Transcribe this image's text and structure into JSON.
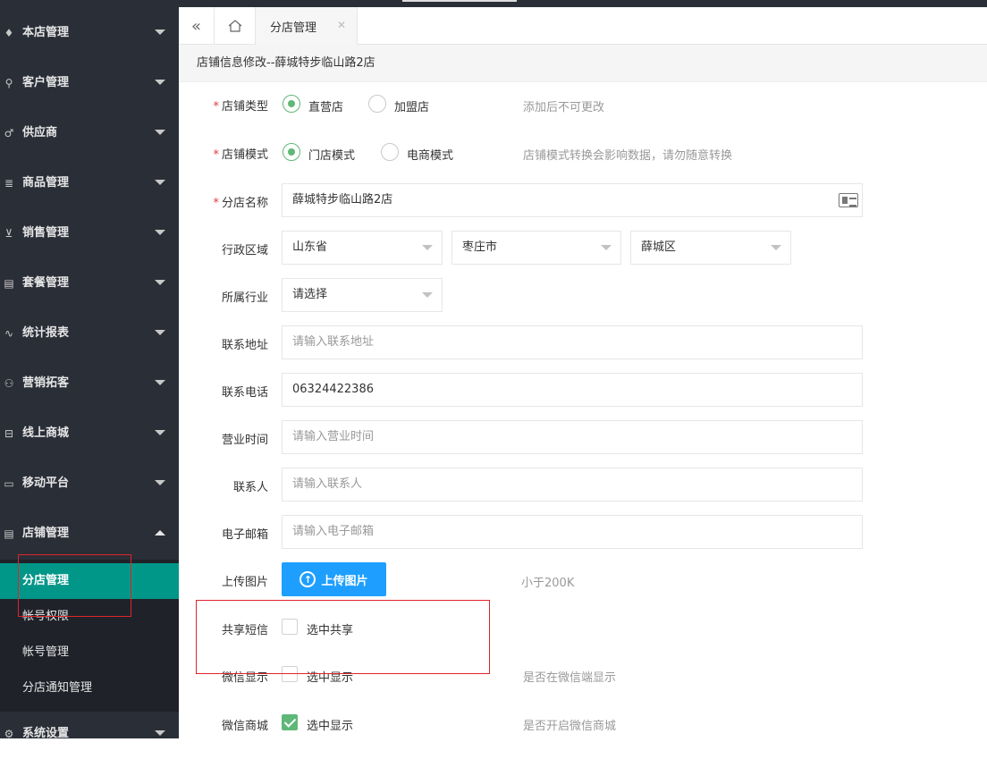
{
  "sidebar": {
    "items": [
      {
        "label": "本店管理",
        "icon": "diamond-icon"
      },
      {
        "label": "客户管理",
        "icon": "user-icon"
      },
      {
        "label": "供应商",
        "icon": "male-icon"
      },
      {
        "label": "商品管理",
        "icon": "document-icon"
      },
      {
        "label": "销售管理",
        "icon": "cart-icon"
      },
      {
        "label": "套餐管理",
        "icon": "package-icon"
      },
      {
        "label": "统计报表",
        "icon": "pulse-icon"
      },
      {
        "label": "营销拓客",
        "icon": "users-icon"
      },
      {
        "label": "线上商城",
        "icon": "store-icon"
      },
      {
        "label": "移动平台",
        "icon": "mobile-icon"
      },
      {
        "label": "店铺管理",
        "icon": "shop-icon"
      },
      {
        "label": "系统设置",
        "icon": "gear-icon"
      }
    ],
    "submenu": [
      {
        "label": "分店管理",
        "active": true
      },
      {
        "label": "帐号权限",
        "active": false
      },
      {
        "label": "帐号管理",
        "active": false
      },
      {
        "label": "分店通知管理",
        "active": false
      }
    ]
  },
  "tabs": {
    "collapse_icon": "double-chevron-left-icon",
    "home_icon": "home-icon",
    "active_tab": "分店管理",
    "close_icon": "close-icon"
  },
  "page": {
    "heading": "店铺信息修改--薛城特步临山路2店"
  },
  "form": {
    "store_type": {
      "label": "店铺类型",
      "options": [
        "直营店",
        "加盟店"
      ],
      "selected": "直营店",
      "hint": "添加后不可更改"
    },
    "store_mode": {
      "label": "店铺模式",
      "options": [
        "门店模式",
        "电商模式"
      ],
      "selected": "门店模式",
      "hint": "店铺模式转换会影响数据，请勿随意转换"
    },
    "branch_name": {
      "label": "分店名称",
      "value": "薛城特步临山路2店"
    },
    "region": {
      "label": "行政区域",
      "province": "山东省",
      "city": "枣庄市",
      "district": "薛城区"
    },
    "industry": {
      "label": "所属行业",
      "value": "请选择"
    },
    "address": {
      "label": "联系地址",
      "placeholder": "请输入联系地址"
    },
    "phone": {
      "label": "联系电话",
      "value": "06324422386"
    },
    "hours": {
      "label": "营业时间",
      "placeholder": "请输入营业时间"
    },
    "contact": {
      "label": "联系人",
      "placeholder": "请输入联系人"
    },
    "email": {
      "label": "电子邮箱",
      "placeholder": "请输入电子邮箱"
    },
    "upload": {
      "label": "上传图片",
      "button": "上传图片",
      "hint": "小于200K"
    },
    "share_sms": {
      "label": "共享短信",
      "option": "选中共享",
      "checked": false
    },
    "wechat_display": {
      "label": "微信显示",
      "option": "选中显示",
      "checked": false,
      "hint": "是否在微信端显示"
    },
    "wechat_mall": {
      "label": "微信商城",
      "option": "选中显示",
      "checked": true,
      "hint": "是否开启微信商城"
    }
  },
  "colors": {
    "sidebar_bg": "#2a2e37",
    "active_green": "#009688",
    "radio_green": "#5fb878",
    "upload_blue": "#1e9fff",
    "required_red": "#e4393c",
    "annotation_red": "#e0242a"
  }
}
